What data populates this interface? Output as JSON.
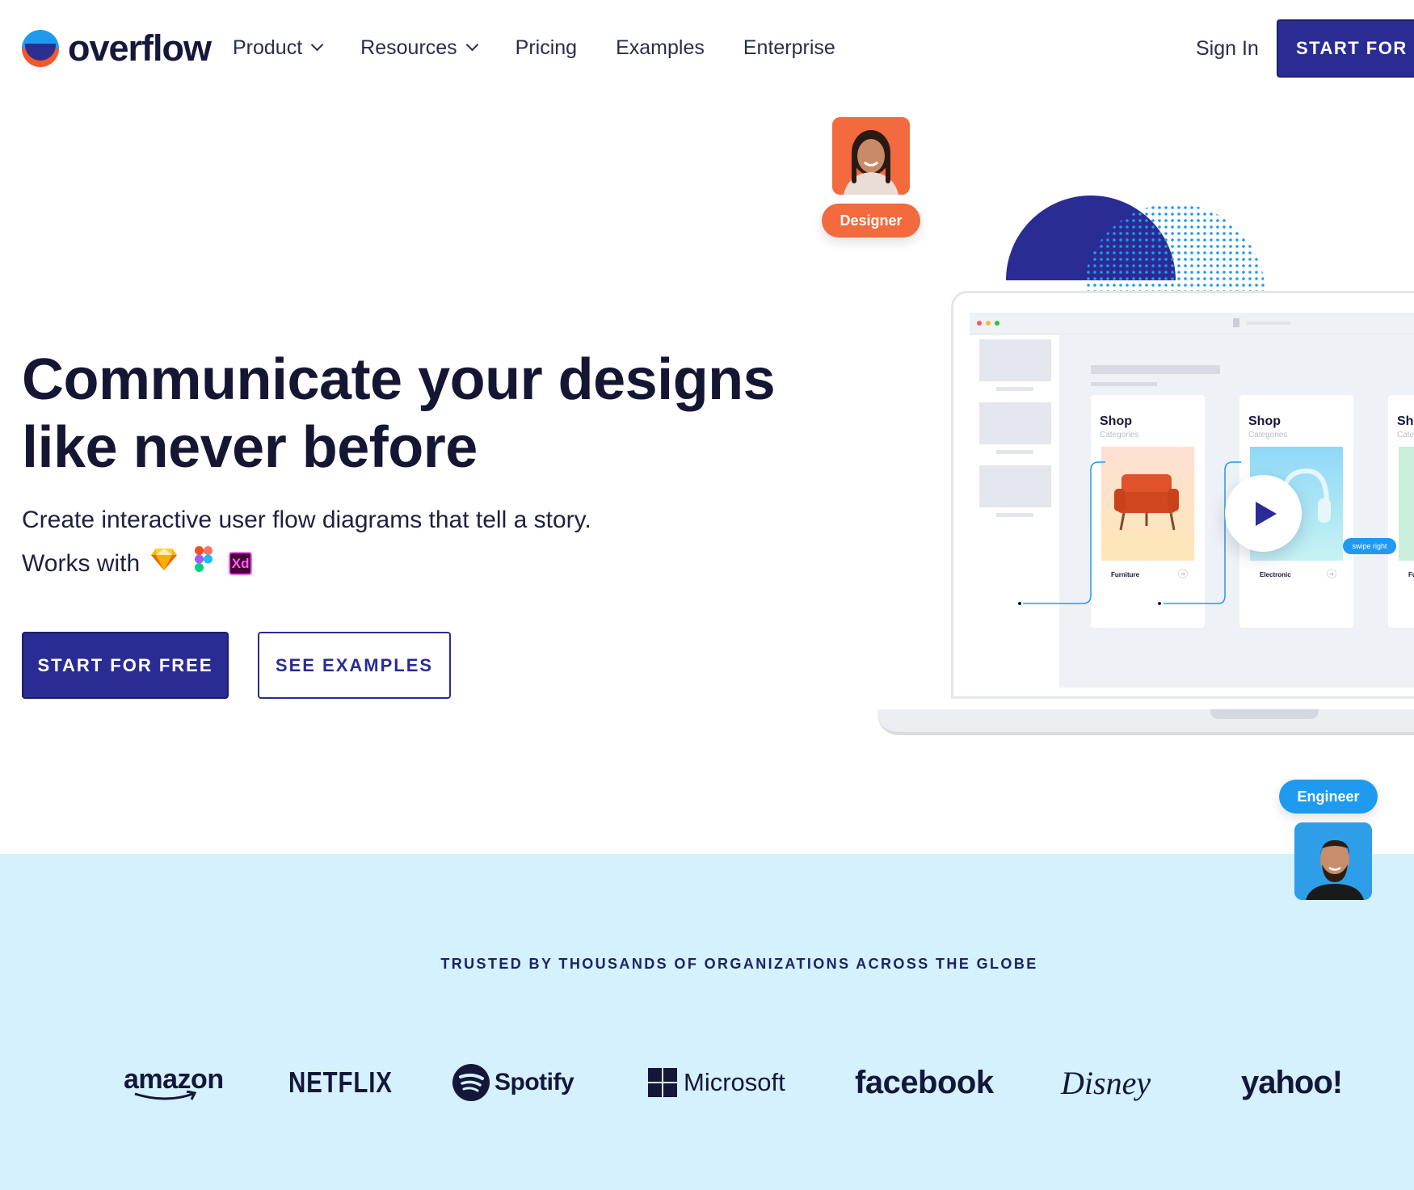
{
  "nav": {
    "logo_text": "overflow",
    "links": [
      {
        "label": "Product",
        "has_dropdown": true
      },
      {
        "label": "Resources",
        "has_dropdown": true
      },
      {
        "label": "Pricing",
        "has_dropdown": false
      },
      {
        "label": "Examples",
        "has_dropdown": false
      },
      {
        "label": "Enterprise",
        "has_dropdown": false
      }
    ],
    "signin_label": "Sign In",
    "cta_label": "START FOR F"
  },
  "hero": {
    "headline_line1": "Communicate your designs",
    "headline_line2": "like never before",
    "subline": "Create interactive user flow diagrams that tell a story.",
    "works_with_label": "Works with",
    "tools": [
      "sketch-icon",
      "figma-icon",
      "xd-icon"
    ],
    "xd_label": "Xd",
    "primary_cta": "START FOR FREE",
    "secondary_cta": "SEE EXAMPLES"
  },
  "illustration": {
    "designer_label": "Designer",
    "engineer_label": "Engineer",
    "cards": [
      {
        "title": "Shop",
        "subtitle": "Categories",
        "footer": "Furniture"
      },
      {
        "title": "Shop",
        "subtitle": "Categories",
        "footer": "Electronic"
      },
      {
        "title": "Sh",
        "subtitle": "Cate",
        "footer": "Fu"
      }
    ],
    "swipe_label": "swipe right"
  },
  "trust": {
    "heading": "TRUSTED BY THOUSANDS OF ORGANIZATIONS ACROSS THE GLOBE",
    "brands": [
      "amazon",
      "NETFLIX",
      "Spotify",
      "Microsoft",
      "facebook",
      "Disney",
      "yahoo!"
    ]
  },
  "colors": {
    "brand_navy": "#2a2c93",
    "brand_orange": "#f26a3d",
    "brand_blue": "#1e9bf0",
    "band_bg": "#d4f1fd",
    "text_dark": "#141633"
  }
}
